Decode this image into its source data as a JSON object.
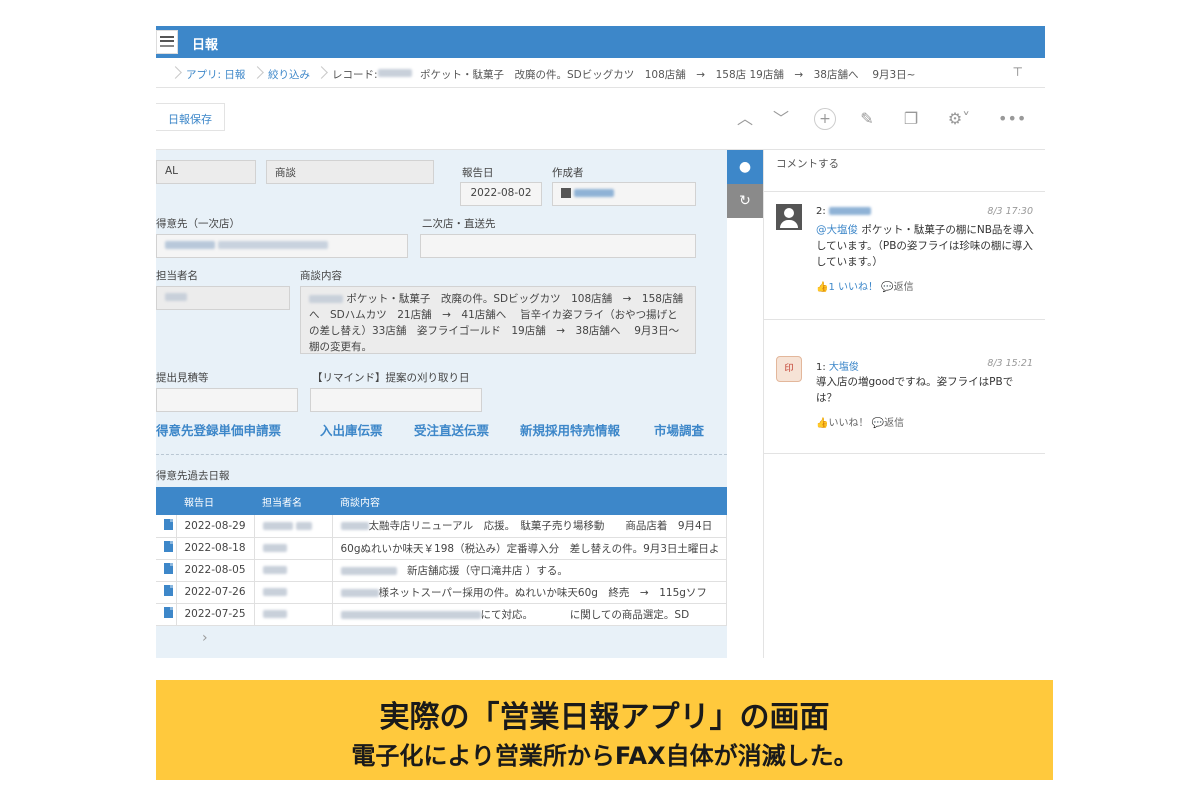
{
  "app": {
    "title": "日報"
  },
  "breadcrumb": {
    "app_label": "アプリ: 日報",
    "filter_label": "絞り込み",
    "record_prefix": "レコード:",
    "record_text": "ポケット・駄菓子　改廃の件。SDビッグカツ　108店舗　→　158店 19店舗　→　38店舗へ　 9月3日~ ..."
  },
  "toolbar": {
    "save_label": "日報保存"
  },
  "form": {
    "field1_value": "AL",
    "field2_value": "商談",
    "report_date_label": "報告日",
    "report_date_value": "2022-08-02",
    "creator_label": "作成者",
    "customer_label": "得意先（一次店）",
    "secondary_label": "二次店・直送先",
    "assignee_label": "担当者名",
    "content_label": "商談内容",
    "content_value": "ポケット・駄菓子　改廃の件。SDビッグカツ　108店舗　→　158店舗へ　SDハムカツ　21店舗　→　41店舗へ　 旨辛イカ姿フライ（おやつ揚げとの差し替え）33店舗　姿フライゴールド　19店舗　→　38店舗へ　 9月3日～　棚の変更有。",
    "estimate_label": "提出見積等",
    "remind_label": "【リマインド】提案の刈り取り日"
  },
  "links": [
    "得意先登録単価申請票",
    "入出庫伝票",
    "受注直送伝票",
    "新規採用特売情報",
    "市場調査"
  ],
  "past": {
    "title": "得意先過去日報",
    "headers": [
      "報告日",
      "担当者名",
      "商談内容"
    ],
    "rows": [
      {
        "date": "2022-08-29",
        "content": "太融寺店リニューアル　応援。　駄菓子売り場移動　　商品店着　9月4日"
      },
      {
        "date": "2022-08-18",
        "content": "60gぬれいか味天￥198（税込み）定番導入分　差し替えの件。9月3日土曜日よ"
      },
      {
        "date": "2022-08-05",
        "content": "新店舗応援（守口滝井店 ）する。"
      },
      {
        "date": "2022-07-26",
        "content": "様ネットスーパー採用の件。ぬれいか味天60g　終売　→　115gソフ"
      },
      {
        "date": "2022-07-25",
        "content": "にて対応。　　　　に関しての商品選定。SD"
      }
    ]
  },
  "comments": {
    "input_placeholder": "コメントする",
    "items": [
      {
        "num": "2:",
        "time": "8/3 17:30",
        "mention": "@大塩俊",
        "body": "ポケット・駄菓子の棚にNB品を導入しています。（PBの姿フライは珍味の棚に導入しています。）",
        "likes": "1",
        "like_label": "いいね！",
        "reply_label": "返信"
      },
      {
        "num": "1:",
        "author": "大塩俊",
        "time": "8/3 15:21",
        "body": "導入店の増goodですね。姿フライはPBでは？",
        "like_label": "いいね！",
        "reply_label": "返信"
      }
    ]
  },
  "banner": {
    "line1": "実際の「営業日報アプリ」の画面",
    "line2": "電子化により営業所からFAX自体が消滅した。"
  },
  "colors": {
    "accent": "#3d87c9",
    "banner": "#ffc93d"
  }
}
